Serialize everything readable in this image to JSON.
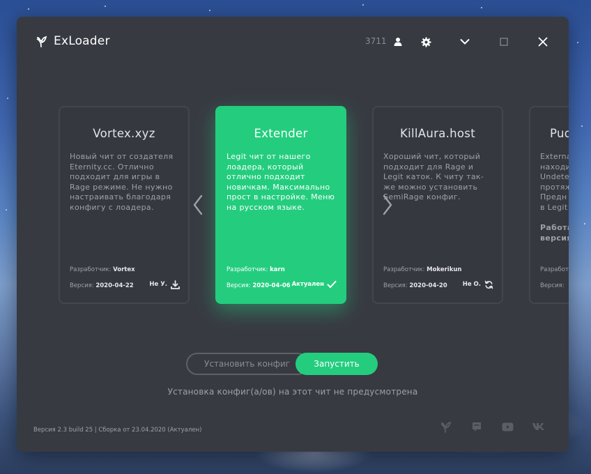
{
  "window": {
    "title": "ExLoader",
    "user_id": "3711"
  },
  "cards": [
    {
      "title": "Vortex.xyz",
      "description": "Новый чит от создателя Eternity.cc. Отлично подходит для игры в Rage режиме. Не нужно настраивать благодаря конфигу с лоадера.",
      "dev_label": "Разработчик:",
      "dev": "Vortex",
      "ver_label": "Версия:",
      "ver": "2020-04-22",
      "status": "Не У.",
      "status_icon": "download-icon"
    },
    {
      "title": "Extender",
      "description": "Legit чит от нашего лоадера, который отлично подходит новичкам. Максимально прост в настройке. Меню на русском языке.",
      "dev_label": "Разработчик:",
      "dev": "karn",
      "ver_label": "Версия:",
      "ver": "2020-04-06",
      "status": "Актуален",
      "status_icon": "check-icon",
      "active": true
    },
    {
      "title": "KillAura.host",
      "description": "Хороший чит, который подходит для Rage и Legit каток. К читу так-же можно установить SemiRage конфиг.",
      "dev_label": "Разработчик:",
      "dev": "Mokerikun",
      "ver_label": "Версия:",
      "ver": "2020-04-20",
      "status": "Не О.",
      "status_icon": "refresh-icon"
    },
    {
      "title": "Pud",
      "description": "Externa\nнаходи\nUndete\nпротяж\nПредн\nв Legit",
      "description2": "Работа\nверсия",
      "dev_label": "Разработ",
      "ver_label": "Версия:"
    }
  ],
  "buttons": {
    "install_config": "Установить конфиг",
    "launch": "Запустить"
  },
  "notice": "Установка конфиг(а/ов) на этот чит не предусмотрена",
  "footer": {
    "version": "Версия 2.3 build 25 | Сборка от 23.04.2020 (Актуален)"
  },
  "colors": {
    "accent": "#24cd7e",
    "window_bg": "#383a42",
    "card_border": "#43464f",
    "muted_text": "#9ea1a9"
  },
  "icons": {
    "logo": "sprout-icon",
    "user": "user-icon",
    "settings": "gear-icon",
    "minimize": "chevron-down-icon",
    "maximize": "square-icon",
    "close": "close-icon",
    "social": [
      "sprout-icon",
      "chat-icon",
      "youtube-icon",
      "vk-icon"
    ]
  }
}
